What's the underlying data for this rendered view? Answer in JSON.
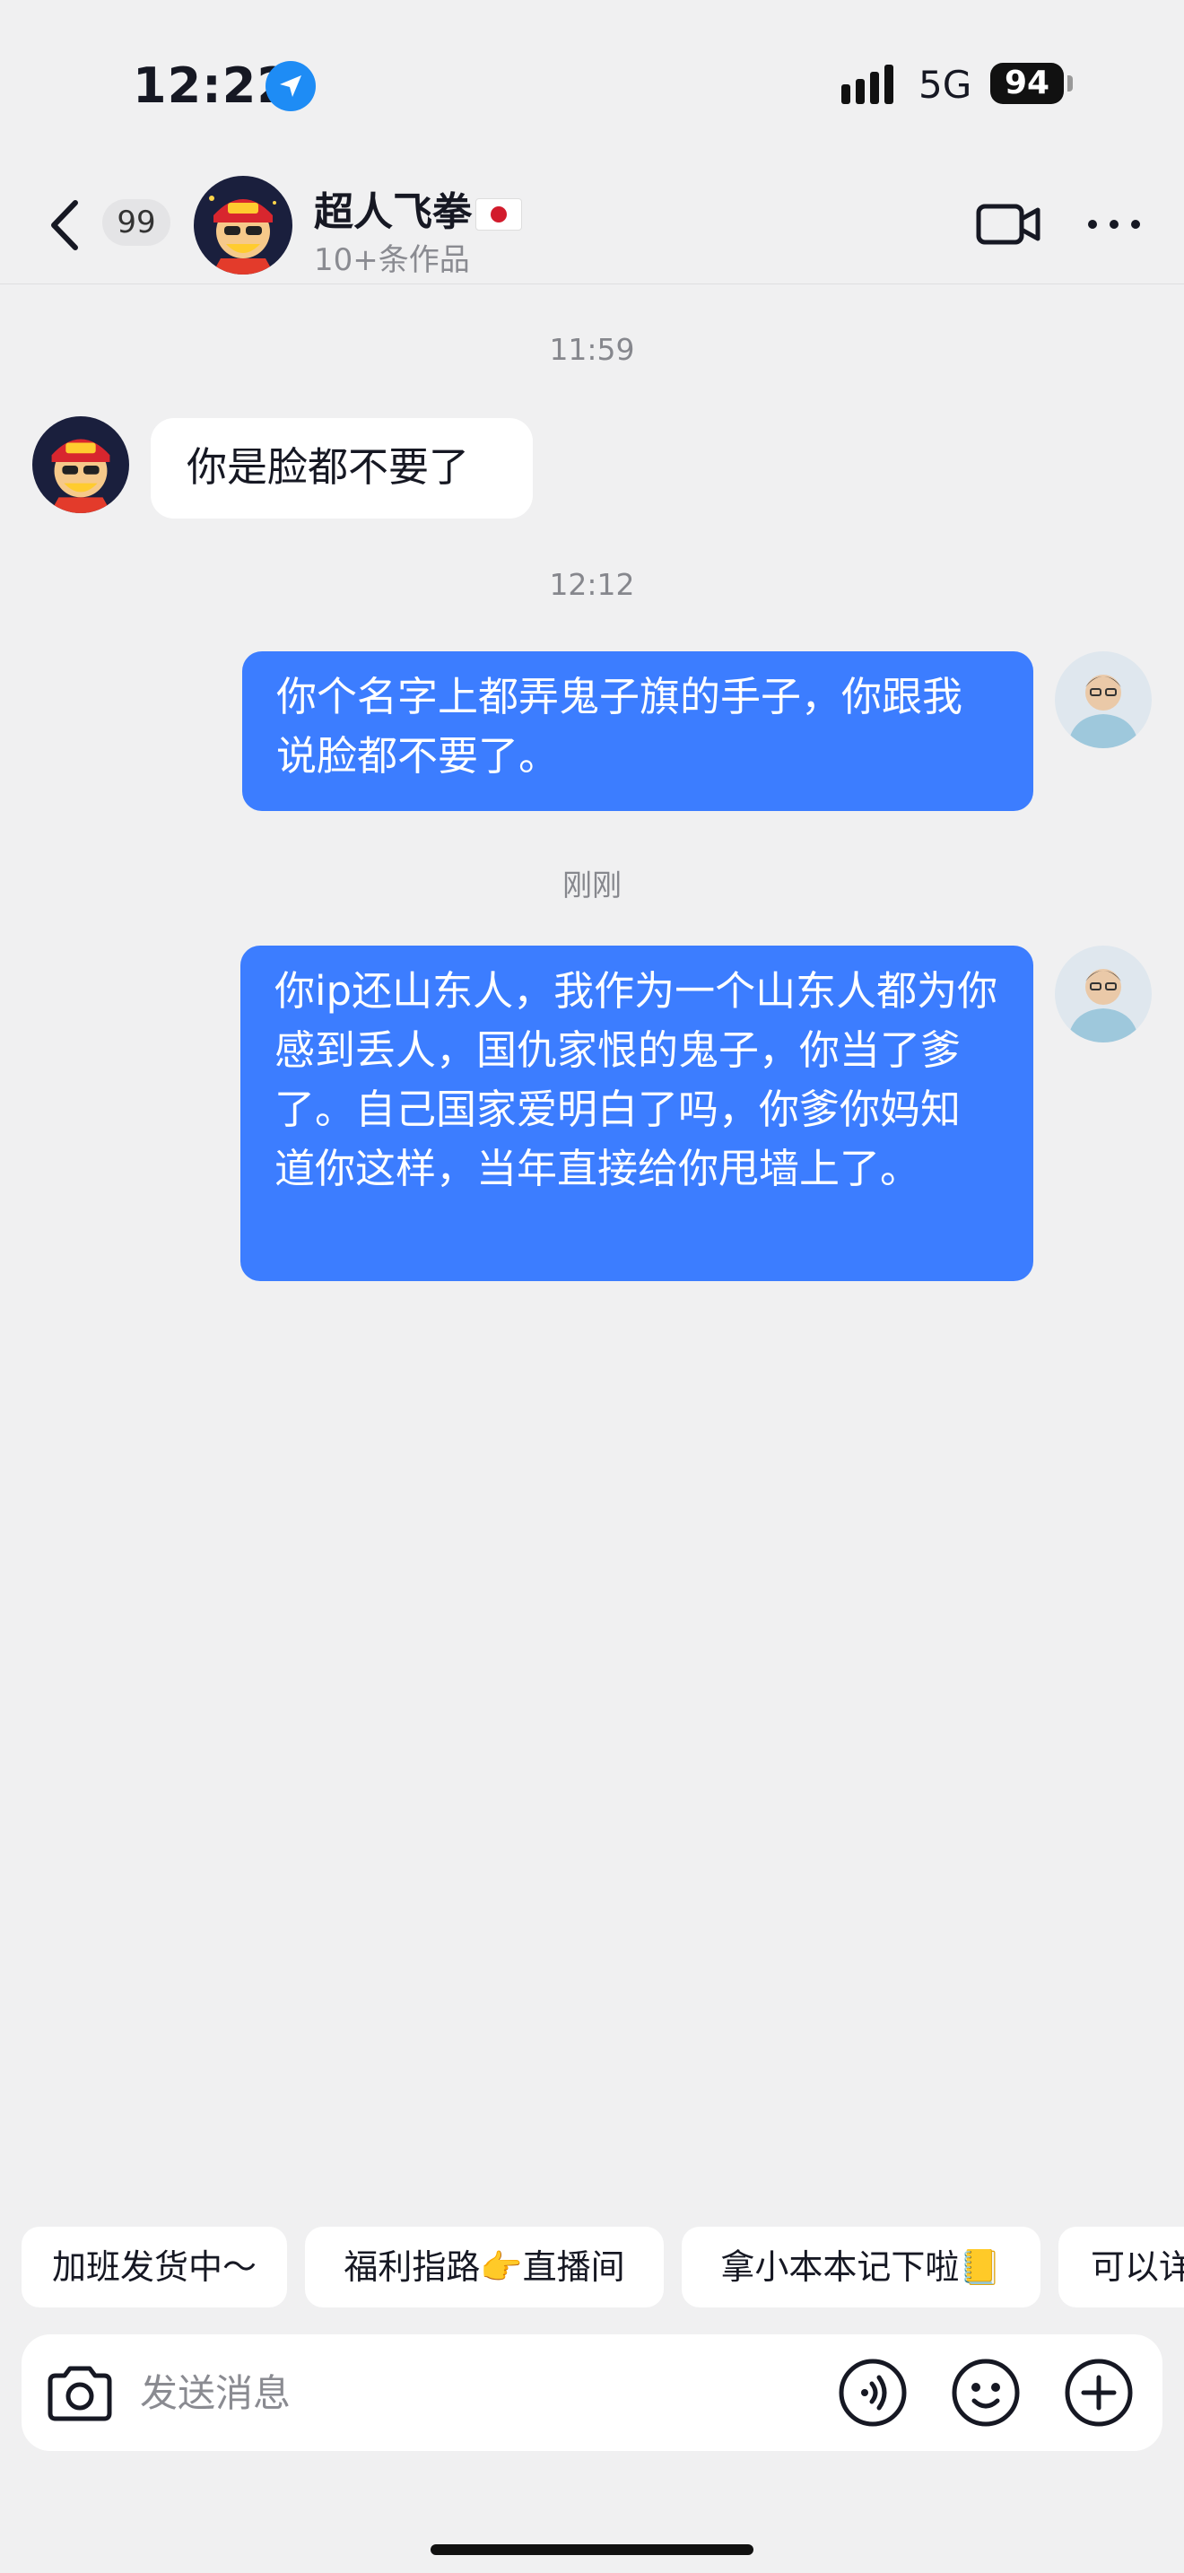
{
  "status_bar": {
    "time": "12:22",
    "network": "5G",
    "battery": "94",
    "location_icon": "location-arrow-icon",
    "signal_icon": "signal-bars-icon"
  },
  "header": {
    "back_icon": "chevron-left-icon",
    "unread_count": "99",
    "contact_name": "超人飞拳",
    "contact_flag": "japan-flag-icon",
    "contact_subtitle": "10+条作品",
    "video_icon": "video-camera-icon",
    "more_icon": "more-dots-icon"
  },
  "messages": [
    {
      "type": "timestamp",
      "text": "11:59"
    },
    {
      "type": "incoming",
      "sender": "超人飞拳",
      "text": "你是脸都不要了"
    },
    {
      "type": "timestamp",
      "text": "12:12"
    },
    {
      "type": "outgoing",
      "text": "你个名字上都弄鬼子旗的手子，你跟我说脸都不要了。"
    },
    {
      "type": "timestamp",
      "text": "刚刚"
    },
    {
      "type": "outgoing",
      "text": "你ip还山东人，我作为一个山东人都为你感到丢人，国仇家恨的鬼子，你当了爹了。自己国家爱明白了吗，你爹你妈知道你这样，当年直接给你甩墙上了。"
    }
  ],
  "quick_replies": [
    {
      "label": "加班发货中～"
    },
    {
      "label": "福利指路👉直播间"
    },
    {
      "label": "拿小本本记下啦📒"
    },
    {
      "label": "可以详"
    }
  ],
  "input_bar": {
    "placeholder": "发送消息",
    "camera_icon": "camera-icon",
    "voice_icon": "voice-icon",
    "emoji_icon": "emoji-icon",
    "plus_icon": "plus-icon"
  },
  "colors": {
    "background": "#f0f0f1",
    "outgoing_bubble": "#3c7dff",
    "incoming_bubble": "#ffffff",
    "location_badge": "#1e8cf5"
  }
}
